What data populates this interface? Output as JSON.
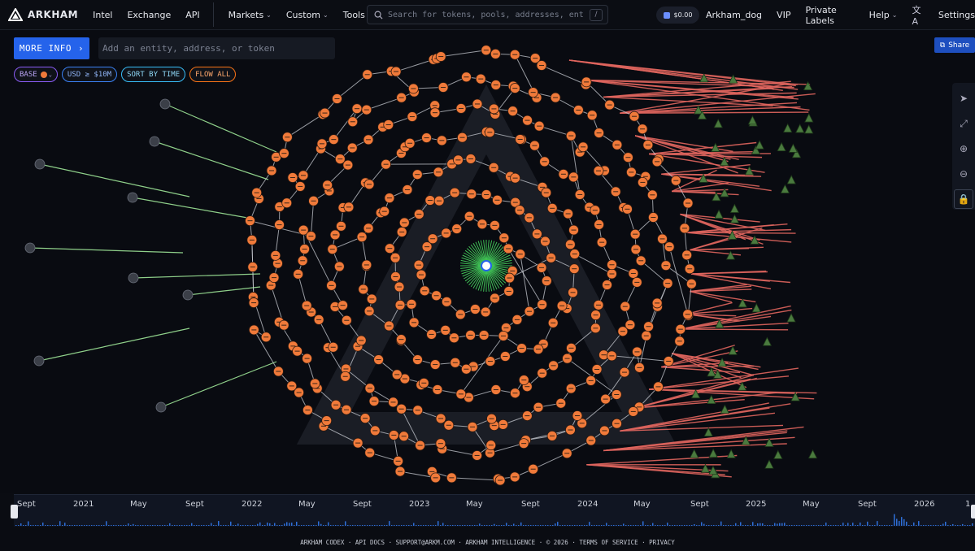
{
  "topbar": {
    "brand": "ARKHAM",
    "nav": [
      "Intel",
      "Exchange",
      "API"
    ],
    "dropdowns": [
      "Markets",
      "Custom",
      "Tools"
    ],
    "search_placeholder": "Search for tokens, pools, addresses, entiti...",
    "search_shortcut": "/",
    "wallet_balance": "$0.00",
    "user": "Arkham_dog",
    "vip": "VIP",
    "private_labels": "Private Labels",
    "help": "Help",
    "settings": "Settings"
  },
  "toolbar": {
    "more_info": "MORE INFO",
    "entity_placeholder": "Add an entity, address, or token",
    "share": "Share"
  },
  "filters": {
    "base": "BASE",
    "usd": "USD ≥ $10M",
    "sort": "SORT BY TIME",
    "flow": "FLOW ALL"
  },
  "colors": {
    "node": "#f07a3a",
    "edge_grey": "#c8cbd2",
    "edge_red": "#e0655e",
    "edge_green": "#8fd08a",
    "accent": "#2563eb"
  },
  "timeline": {
    "labels": [
      "Sept",
      "2021",
      "May",
      "Sept",
      "2022",
      "May",
      "Sept",
      "2023",
      "May",
      "Sept",
      "2024",
      "May",
      "Sept",
      "2025",
      "May",
      "Sept",
      "2026",
      "1"
    ]
  },
  "footer": "ARKHAM CODEX · API DOCS · SUPPORT@ARKM.COM · ARKHAM INTELLIGENCE · © 2026 · TERMS OF SERVICE · PRIVACY"
}
